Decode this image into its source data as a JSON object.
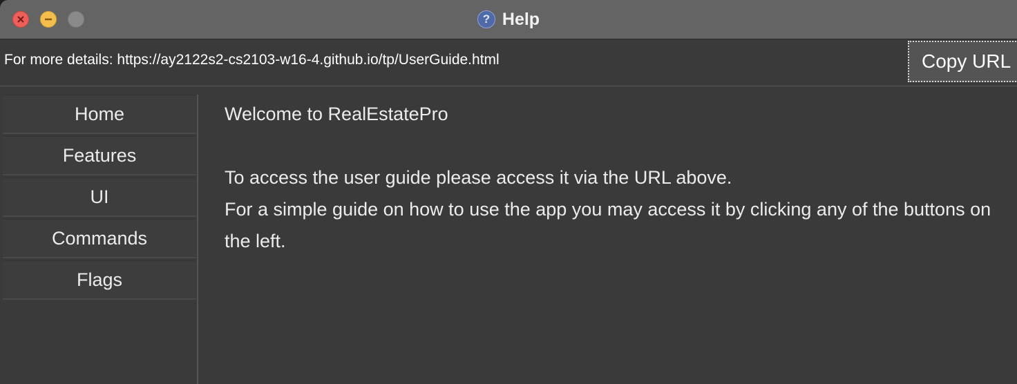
{
  "window": {
    "title": "Help",
    "controls": {
      "close_icon": "close-icon",
      "minimize_icon": "minimize-icon",
      "zoom_icon": "zoom-icon"
    },
    "title_icon": "?"
  },
  "url_bar": {
    "text": "For more details: https://ay2122s2-cs2103-w16-4.github.io/tp/UserGuide.html",
    "copy_button_label": "Copy URL"
  },
  "sidebar": {
    "items": [
      {
        "label": "Home"
      },
      {
        "label": "Features"
      },
      {
        "label": "UI"
      },
      {
        "label": "Commands"
      },
      {
        "label": "Flags"
      }
    ]
  },
  "content": {
    "heading": "Welcome to RealEstatePro",
    "paragraph_line1": "To access the user guide please access it via the URL above.",
    "paragraph_line2": "For a simple guide on how to use the app you may access it by clicking any of the buttons on",
    "paragraph_line3": "the left."
  },
  "colors": {
    "window_bg": "#3a3a3a",
    "titlebar_bg": "#646464",
    "close": "#ec5f5a",
    "minimize": "#f4be4f",
    "zoom_disabled": "#8a8a8a",
    "text": "#ececec"
  }
}
